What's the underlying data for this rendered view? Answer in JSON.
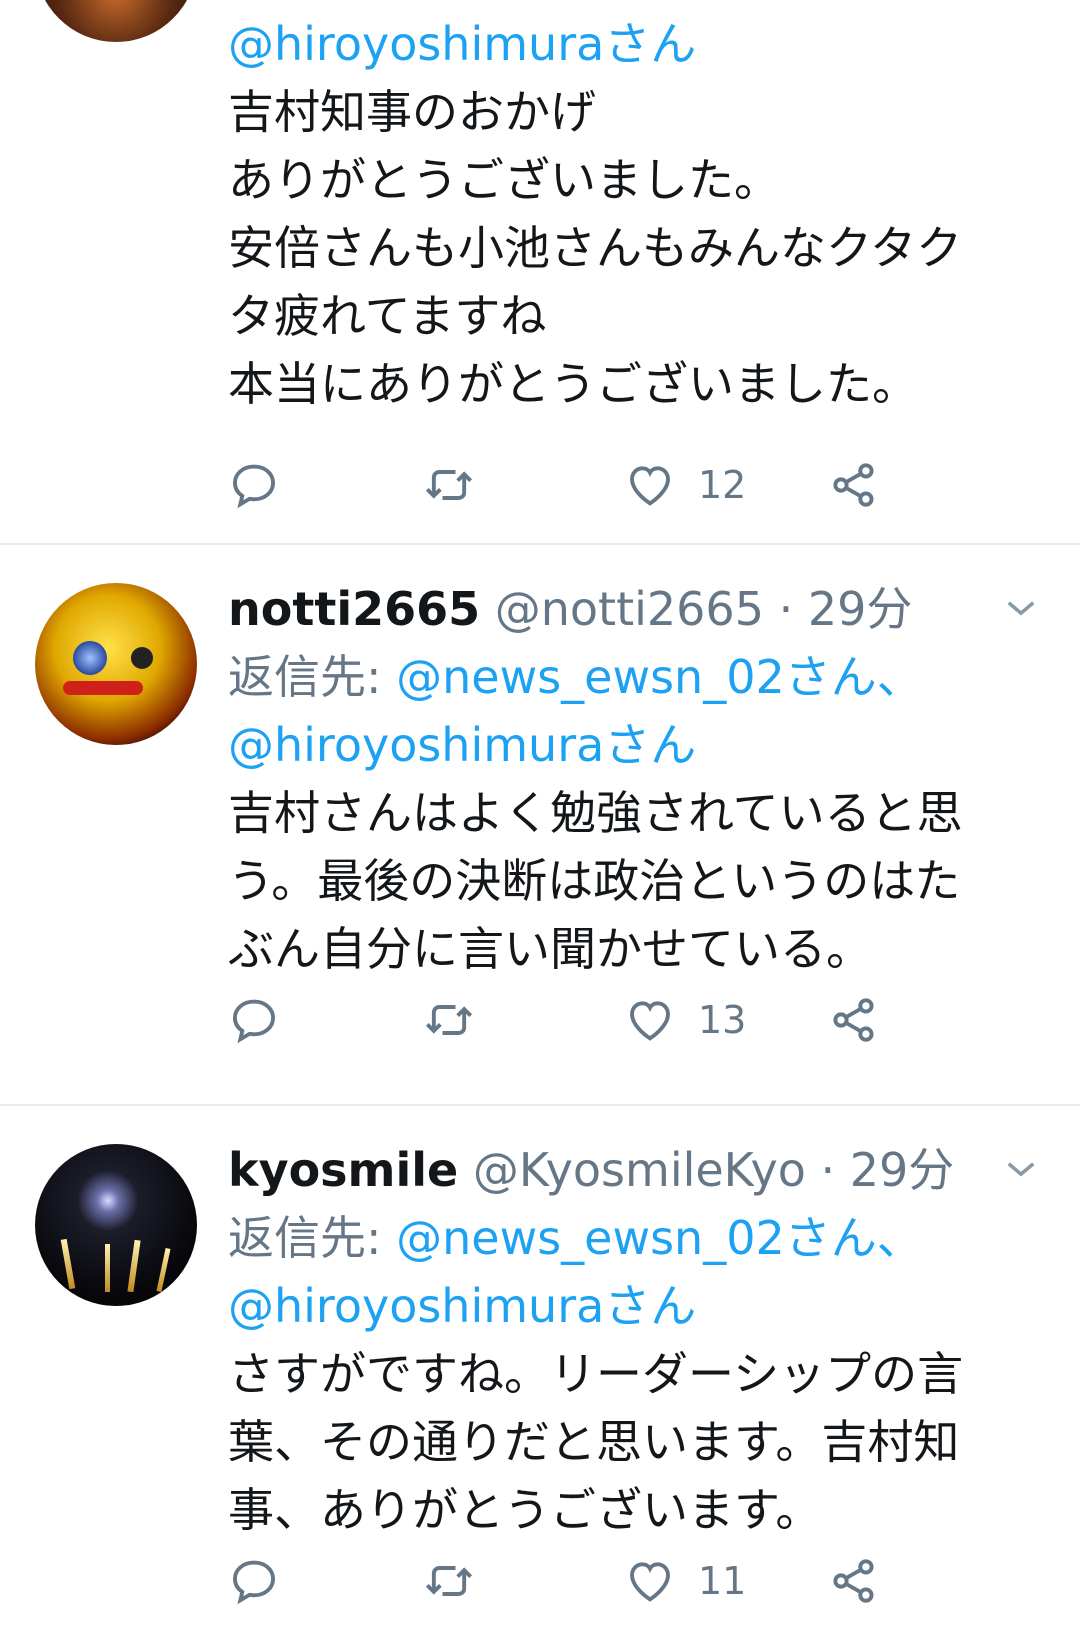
{
  "tweets": [
    {
      "reply_handle_partial": "@hiroyoshimuraさん",
      "text_lines": [
        "吉村知事のおかげ",
        "ありがとうございました。",
        "安倍さんも小池さんもみんなクタク",
        "タ疲れてますね",
        "本当にありがとうございました。"
      ],
      "likes": "12"
    },
    {
      "name": "notti2665",
      "handle": "@notti2665",
      "time": "· 29分",
      "reply_prefix": "返信先:",
      "reply_to_1": "@news_ewsn_02さん、",
      "reply_to_2": "@hiroyoshimuraさん",
      "text_lines": [
        "吉村さんはよく勉強されていると思",
        "う。最後の決断は政治というのはた",
        "ぶん自分に言い聞かせている。"
      ],
      "likes": "13"
    },
    {
      "name": "kyosmile",
      "handle": "@KyosmileKyo",
      "time": "· 29分",
      "reply_prefix": "返信先:",
      "reply_to_1": "@news_ewsn_02さん、",
      "reply_to_2": "@hiroyoshimuraさん",
      "text_lines": [
        "さすがですね。リーダーシップの言",
        "葉、その通りだと思います。吉村知",
        "事、ありがとうございます。"
      ],
      "likes": "11"
    }
  ],
  "icons": {
    "reply": "reply-icon",
    "retweet": "retweet-icon",
    "like": "heart-icon",
    "share": "share-icon",
    "more": "chevron-down-icon"
  },
  "colors": {
    "link": "#1da1f2",
    "meta": "#657786",
    "divider": "#e6ecf0"
  }
}
